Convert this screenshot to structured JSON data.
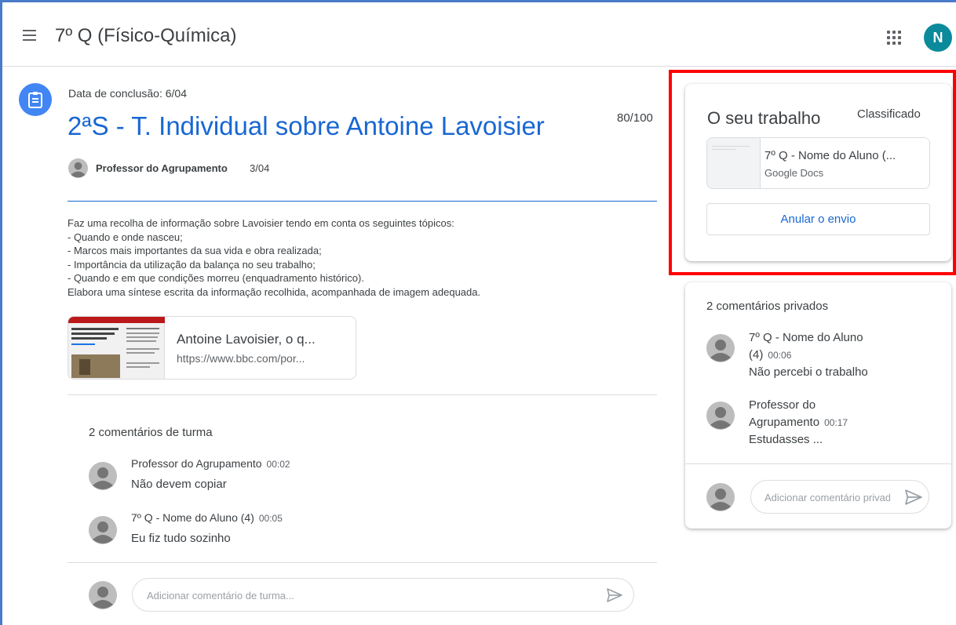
{
  "header": {
    "class_title": "7º Q (Físico-Química)",
    "user_initial": "N",
    "user_avatar_color": "#0b8a9b"
  },
  "assignment": {
    "due_date": "Data de conclusão: 6/04",
    "title": "2ªS - T. Individual sobre Antoine Lavoisier",
    "points": "80/100",
    "author": "Professor do Agrupamento",
    "posted_date": "3/04",
    "description": "Faz uma recolha de informação sobre Lavoisier tendo em conta os seguintes tópicos:\n- Quando e onde nasceu;\n- Marcos mais importantes da sua vida e obra realizada;\n- Importância da utilização da balança no seu trabalho;\n- Quando e em que condições morreu (enquadramento histórico).\nElabora uma síntese escrita da informação recolhida, acompanhada de imagem adequada.",
    "link": {
      "title": "Antoine Lavoisier, o q...",
      "url": "https://www.bbc.com/por..."
    },
    "accent_color": "#1967d2"
  },
  "class_comments": {
    "title": "2 comentários de turma",
    "items": [
      {
        "author": "Professor do Agrupamento",
        "time": "00:02",
        "text": "Não devem copiar"
      },
      {
        "author": "7º Q - Nome do Aluno (4)",
        "time": "00:05",
        "text": "Eu fiz tudo sozinho"
      }
    ],
    "input_placeholder": "Adicionar comentário de turma..."
  },
  "your_work": {
    "title": "O seu trabalho",
    "status": "Classificado",
    "attachment": {
      "name": "7º Q - Nome do Aluno (...",
      "type": "Google Docs"
    },
    "unsubmit_label": "Anular o envio",
    "highlight_color": "#ff0000"
  },
  "private_comments": {
    "title": "2 comentários privados",
    "items": [
      {
        "author": "7º Q - Nome do Aluno (4)",
        "time": "00:06",
        "text": "Não percebi o trabalho"
      },
      {
        "author": "Professor do Agrupamento",
        "time": "00:17",
        "text": "Estudasses ..."
      }
    ],
    "input_placeholder": "Adicionar comentário privado"
  },
  "icons": [
    "menu-icon",
    "apps-grid-icon",
    "assignment-icon",
    "send-icon",
    "person-icon"
  ]
}
